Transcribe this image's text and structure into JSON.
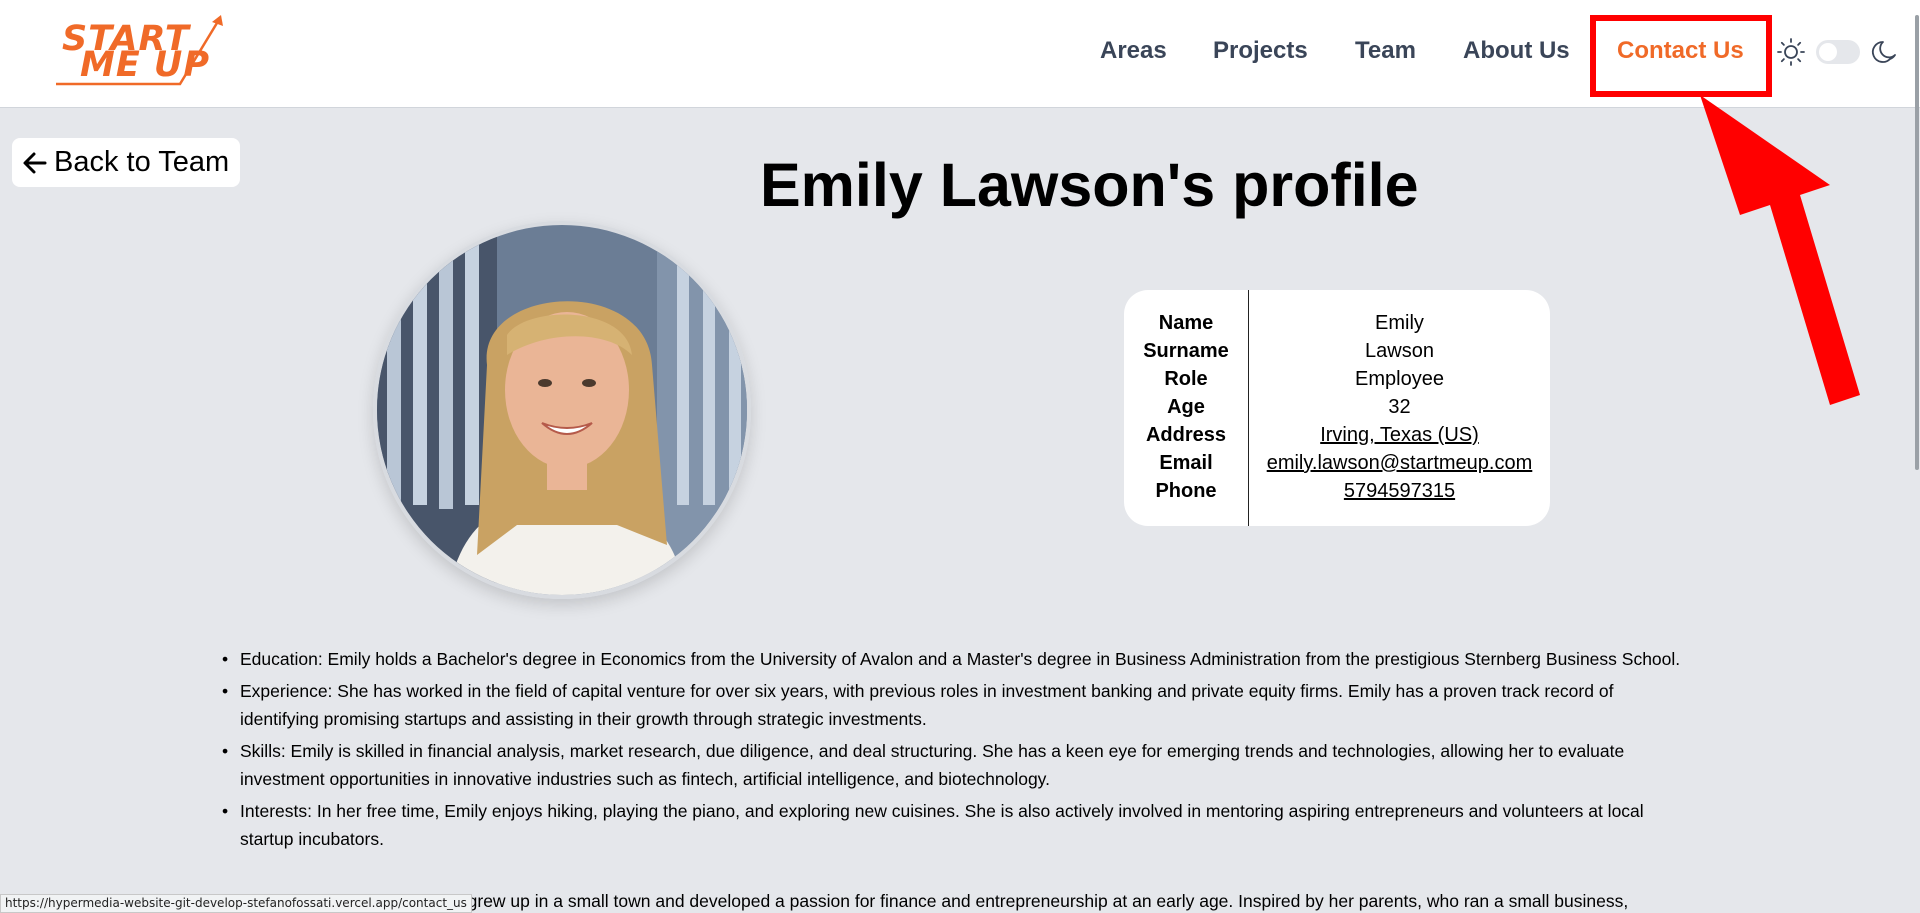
{
  "brand": {
    "logo_line1": "START",
    "logo_line2": "ME UP",
    "accent_color": "#f06a28"
  },
  "nav": {
    "areas": "Areas",
    "projects": "Projects",
    "team": "Team",
    "about": "About Us",
    "contact": "Contact Us",
    "active": "Contact Us",
    "theme_toggle": "light"
  },
  "back_button": {
    "label": "Back to Team",
    "icon": "arrow-left-icon"
  },
  "profile": {
    "title": "Emily Lawson's profile",
    "fields": {
      "name": {
        "label": "Name",
        "value": "Emily"
      },
      "surname": {
        "label": "Surname",
        "value": "Lawson"
      },
      "role": {
        "label": "Role",
        "value": "Employee"
      },
      "age": {
        "label": "Age",
        "value": "32"
      },
      "address": {
        "label": "Address",
        "value": "Irving, Texas (US)"
      },
      "email": {
        "label": "Email",
        "value": "emily.lawson@startmeup.com"
      },
      "phone": {
        "label": "Phone",
        "value": "5794597315"
      }
    },
    "bio": [
      "Education: Emily holds a Bachelor's degree in Economics from the University of Avalon and a Master's degree in Business Administration from the prestigious Sternberg Business School.",
      "Experience: She has worked in the field of capital venture for over six years, with previous roles in investment banking and private equity firms. Emily has a proven track record of identifying promising startups and assisting in their growth through strategic investments.",
      "Skills: Emily is skilled in financial analysis, market research, due diligence, and deal structuring. She has a keen eye for emerging trends and technologies, allowing her to evaluate investment opportunities in innovative industries such as fintech, artificial intelligence, and biotechnology.",
      "Interests: In her free time, Emily enjoys hiking, playing the piano, and exploring new cuisines. She is also actively involved in mentoring aspiring entrepreneurs and volunteers at local startup incubators."
    ],
    "bio_partial": "Emily grew up in a small town and developed a passion for finance and entrepreneurship at an early age. Inspired by her parents, who ran a small business,"
  },
  "status_bar": {
    "url": "https://hypermedia-website-git-develop-stefanofossati.vercel.app/contact_us"
  }
}
